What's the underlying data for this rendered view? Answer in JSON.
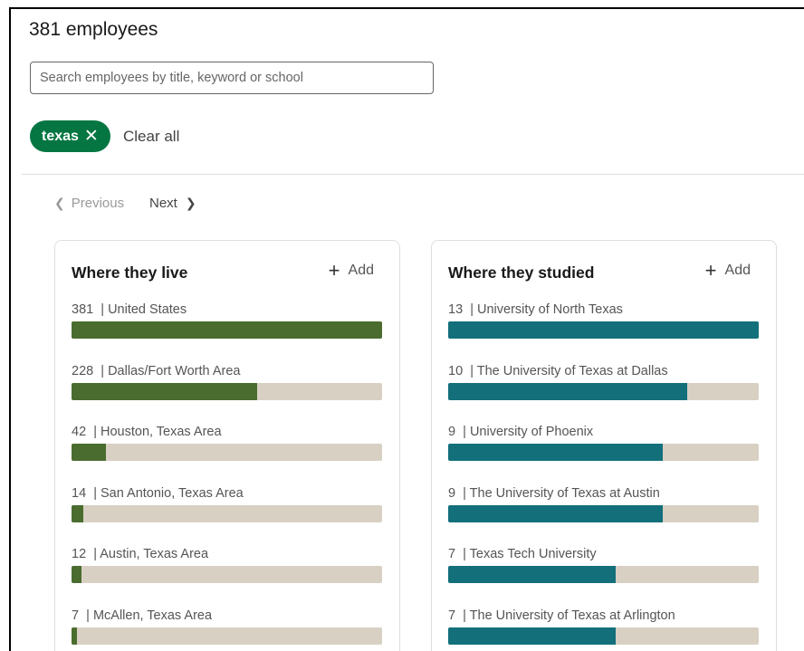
{
  "header": {
    "title": "381 employees"
  },
  "search": {
    "placeholder": "Search employees by title, keyword or school"
  },
  "filters": {
    "pill_label": "texas",
    "pill_close": "✕",
    "clear_label": "Clear all"
  },
  "pager": {
    "previous": "Previous",
    "next": "Next",
    "prev_chevron": "❮",
    "next_chevron": "❯"
  },
  "colors": {
    "live_bar": "#4a6c2f",
    "studied_bar": "#13707b",
    "track": "#d9d0c4",
    "pill": "#057642"
  },
  "cards": [
    {
      "title": "Where they live",
      "add_label": "Add",
      "max": 381,
      "rows": [
        {
          "count": "381",
          "label": "United States",
          "value": 381
        },
        {
          "count": "228",
          "label": "Dallas/Fort Worth Area",
          "value": 228
        },
        {
          "count": "42",
          "label": "Houston, Texas Area",
          "value": 42
        },
        {
          "count": "14",
          "label": "San Antonio, Texas Area",
          "value": 14
        },
        {
          "count": "12",
          "label": "Austin, Texas Area",
          "value": 12
        },
        {
          "count": "7",
          "label": "McAllen, Texas Area",
          "value": 7
        }
      ]
    },
    {
      "title": "Where they studied",
      "add_label": "Add",
      "max": 13,
      "rows": [
        {
          "count": "13",
          "label": "University of North Texas",
          "value": 13
        },
        {
          "count": "10",
          "label": "The University of Texas at Dallas",
          "value": 10
        },
        {
          "count": "9",
          "label": "University of Phoenix",
          "value": 9
        },
        {
          "count": "9",
          "label": "The University of Texas at Austin",
          "value": 9
        },
        {
          "count": "7",
          "label": "Texas Tech University",
          "value": 7
        },
        {
          "count": "7",
          "label": "The University of Texas at Arlington",
          "value": 7
        }
      ]
    }
  ]
}
